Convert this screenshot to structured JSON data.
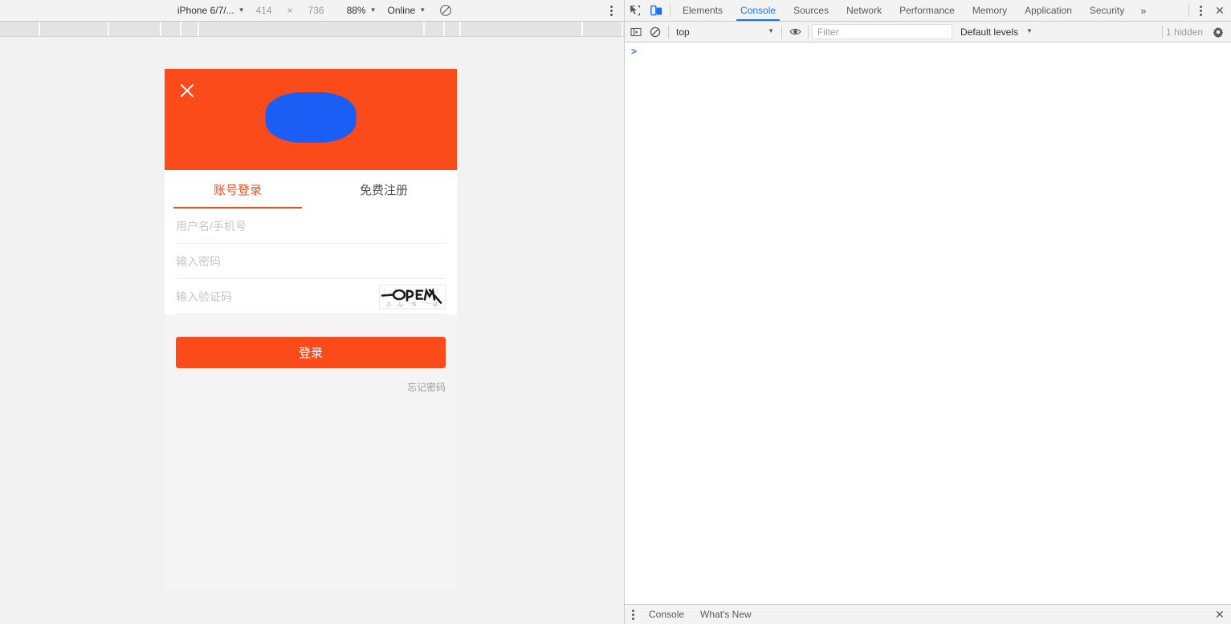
{
  "device_toolbar": {
    "device_name": "iPhone 6/7/...",
    "width": "414",
    "dimension_separator": "×",
    "height": "736",
    "zoom": "88%",
    "network": "Online",
    "throttle_icon": "no-throttling-icon",
    "more_icon": "more-options-icon"
  },
  "mobile_page": {
    "header": {
      "close_icon": "close-icon",
      "logo": "brand-logo-placeholder",
      "background_color": "#fb4b1b",
      "logo_color": "#1a5ef5"
    },
    "tabs": [
      {
        "label": "账号登录",
        "active": true
      },
      {
        "label": "免费注册",
        "active": false
      }
    ],
    "fields": [
      {
        "name": "username",
        "placeholder": "用户名/手机号",
        "value": ""
      },
      {
        "name": "password",
        "placeholder": "输入密码",
        "value": ""
      },
      {
        "name": "captcha",
        "placeholder": "输入验证码",
        "value": "",
        "image": "captcha-image"
      }
    ],
    "submit_label": "登录",
    "forgot_label": "忘记密码",
    "accent_color": "#fb4b1b"
  },
  "devtools": {
    "left_icons": [
      "inspect-element-icon",
      "device-toolbar-icon"
    ],
    "tabs": [
      {
        "label": "Elements",
        "active": false
      },
      {
        "label": "Console",
        "active": true
      },
      {
        "label": "Sources",
        "active": false
      },
      {
        "label": "Network",
        "active": false
      },
      {
        "label": "Performance",
        "active": false
      },
      {
        "label": "Memory",
        "active": false
      },
      {
        "label": "Application",
        "active": false
      },
      {
        "label": "Security",
        "active": false
      }
    ],
    "more_tabs_glyph": "»",
    "menu_icon": "more-tools-icon",
    "close_label": "✕",
    "console_toolbar": {
      "sidebar_icon": "console-sidebar-icon",
      "clear_icon": "clear-console-icon",
      "context": "top",
      "eye_icon": "create-live-expression-icon",
      "filter_placeholder": "Filter",
      "filter_value": "",
      "levels_label": "Default levels",
      "hidden_label": "1 hidden",
      "settings_icon": "settings-gear-icon"
    },
    "console": {
      "prompt_glyph": ">",
      "prompt_value": ""
    },
    "drawer": {
      "menu_icon": "drawer-more-icon",
      "tabs": [
        {
          "label": "Console",
          "active": true
        },
        {
          "label": "What's New",
          "active": false
        }
      ],
      "close_label": "✕"
    },
    "accent_color": "#1a73e8"
  }
}
